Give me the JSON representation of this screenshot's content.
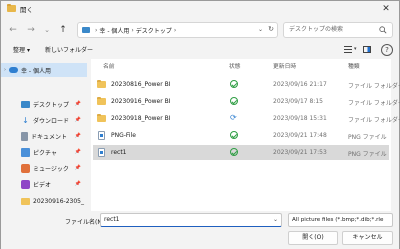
{
  "window": {
    "title": "開く"
  },
  "nav": {
    "back": "←",
    "forward": "→",
    "recent": "⌄",
    "up": "↑"
  },
  "address": {
    "parts": [
      "幸 - 個人用",
      "デスクトップ"
    ]
  },
  "search": {
    "placeholder": "デスクトップの検索"
  },
  "toolbar": {
    "organize": "整理",
    "new_folder": "新しいフォルダー"
  },
  "sidebar": {
    "items": [
      {
        "label": "幸 - 個人用",
        "icon": "cloud-icon"
      },
      {
        "label": "デスクトップ",
        "icon": "desktop-icon"
      },
      {
        "label": "ダウンロード",
        "icon": "download-icon"
      },
      {
        "label": "ドキュメント",
        "icon": "documents-icon"
      },
      {
        "label": "ピクチャ",
        "icon": "pictures-icon"
      },
      {
        "label": "ミュージック",
        "icon": "music-icon"
      },
      {
        "label": "ビデオ",
        "icon": "video-icon"
      },
      {
        "label": "20230916-2305_",
        "icon": "folder-icon"
      }
    ]
  },
  "columns": {
    "name": "名前",
    "status": "状態",
    "modified": "更新日時",
    "type": "種類"
  },
  "files": [
    {
      "name": "20230816_Power BI",
      "modified": "2023/09/16 21:17",
      "type": "ファイル フォルダー",
      "icon": "folder-icon",
      "status": "synced"
    },
    {
      "name": "20230916_Power BI",
      "modified": "2023/09/17 8:15",
      "type": "ファイル フォルダー",
      "icon": "folder-icon",
      "status": "synced"
    },
    {
      "name": "20230918_Power BI",
      "modified": "2023/09/18 15:31",
      "type": "ファイル フォルダー",
      "icon": "folder-icon",
      "status": "syncing"
    },
    {
      "name": "PNG-File",
      "modified": "2023/09/21 17:48",
      "type": "PNG ファイル",
      "icon": "png-file-icon",
      "status": "synced"
    },
    {
      "name": "rect1",
      "modified": "2023/09/21 17:53",
      "type": "PNG ファイル",
      "icon": "png-file-icon",
      "status": "synced"
    }
  ],
  "bottom": {
    "filename_label": "ファイル名(N):",
    "filename_value": "rect1",
    "filetype": "All picture files (*.bmp;*.dib;*.rle",
    "open": "開く(O)",
    "cancel": "キャンセル"
  },
  "colors": {
    "selection": "#cfe3f7",
    "row_selected": "#d9d9d9",
    "synced": "#2f9e44",
    "accent": "#1f5fbf"
  }
}
